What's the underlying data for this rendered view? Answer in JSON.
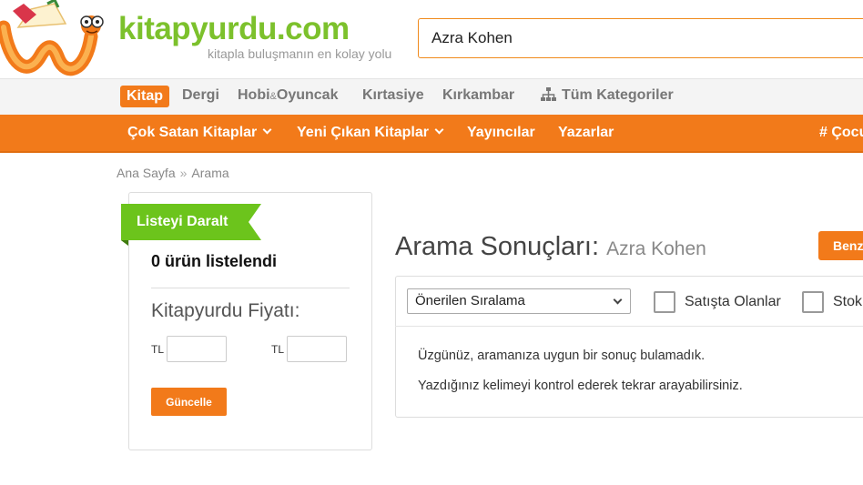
{
  "header": {
    "logo_text": "kitapyurdu.com",
    "tagline": "kitapla buluşmanın en kolay yolu",
    "search_value": "Azra Kohen"
  },
  "categories": [
    {
      "label": "Kitap",
      "active": true
    },
    {
      "label": "Dergi",
      "active": false
    },
    {
      "label": "Hobi",
      "amp": "&",
      "label2": "Oyuncak",
      "active": false
    },
    {
      "label": "Kırtasiye",
      "active": false
    },
    {
      "label": "Kırkambar",
      "active": false
    },
    {
      "label": "Tüm Kategoriler",
      "icon": "sitemap-icon",
      "active": false
    }
  ],
  "nav": {
    "items": [
      {
        "label": "Çok Satan Kitaplar",
        "dropdown": true
      },
      {
        "label": "Yeni Çıkan Kitaplar",
        "dropdown": true
      },
      {
        "label": "Yayıncılar",
        "dropdown": false
      },
      {
        "label": "Yazarlar",
        "dropdown": false
      },
      {
        "label": "# Çocu",
        "dropdown": false
      }
    ]
  },
  "breadcrumb": {
    "items": [
      "Ana Sayfa",
      "Arama"
    ],
    "separator": "»"
  },
  "filter": {
    "ribbon_label": "Listeyi Daralt",
    "count_text": "0 ürün listelendi",
    "price_title": "Kitapyurdu Fiyatı:",
    "currency_min": "TL",
    "currency_max": "TL",
    "update_label": "Güncelle"
  },
  "results": {
    "title": "Arama Sonuçları:",
    "query": "Azra Kohen",
    "compare_label": "Benz",
    "sort_value": "Önerilen Sıralama",
    "checkbox_1": "Satışta Olanlar",
    "checkbox_2": "Stok",
    "message_1": "Üzgünüz, aramanıza uygun bir sonuç bulamadık.",
    "message_2": "Yazdığınız kelimeyi kontrol ederek tekrar arayabilirsiniz."
  },
  "colors": {
    "brand_orange": "#f27a1a",
    "brand_green": "#7cc12c",
    "ribbon_green": "#6cc41c"
  }
}
